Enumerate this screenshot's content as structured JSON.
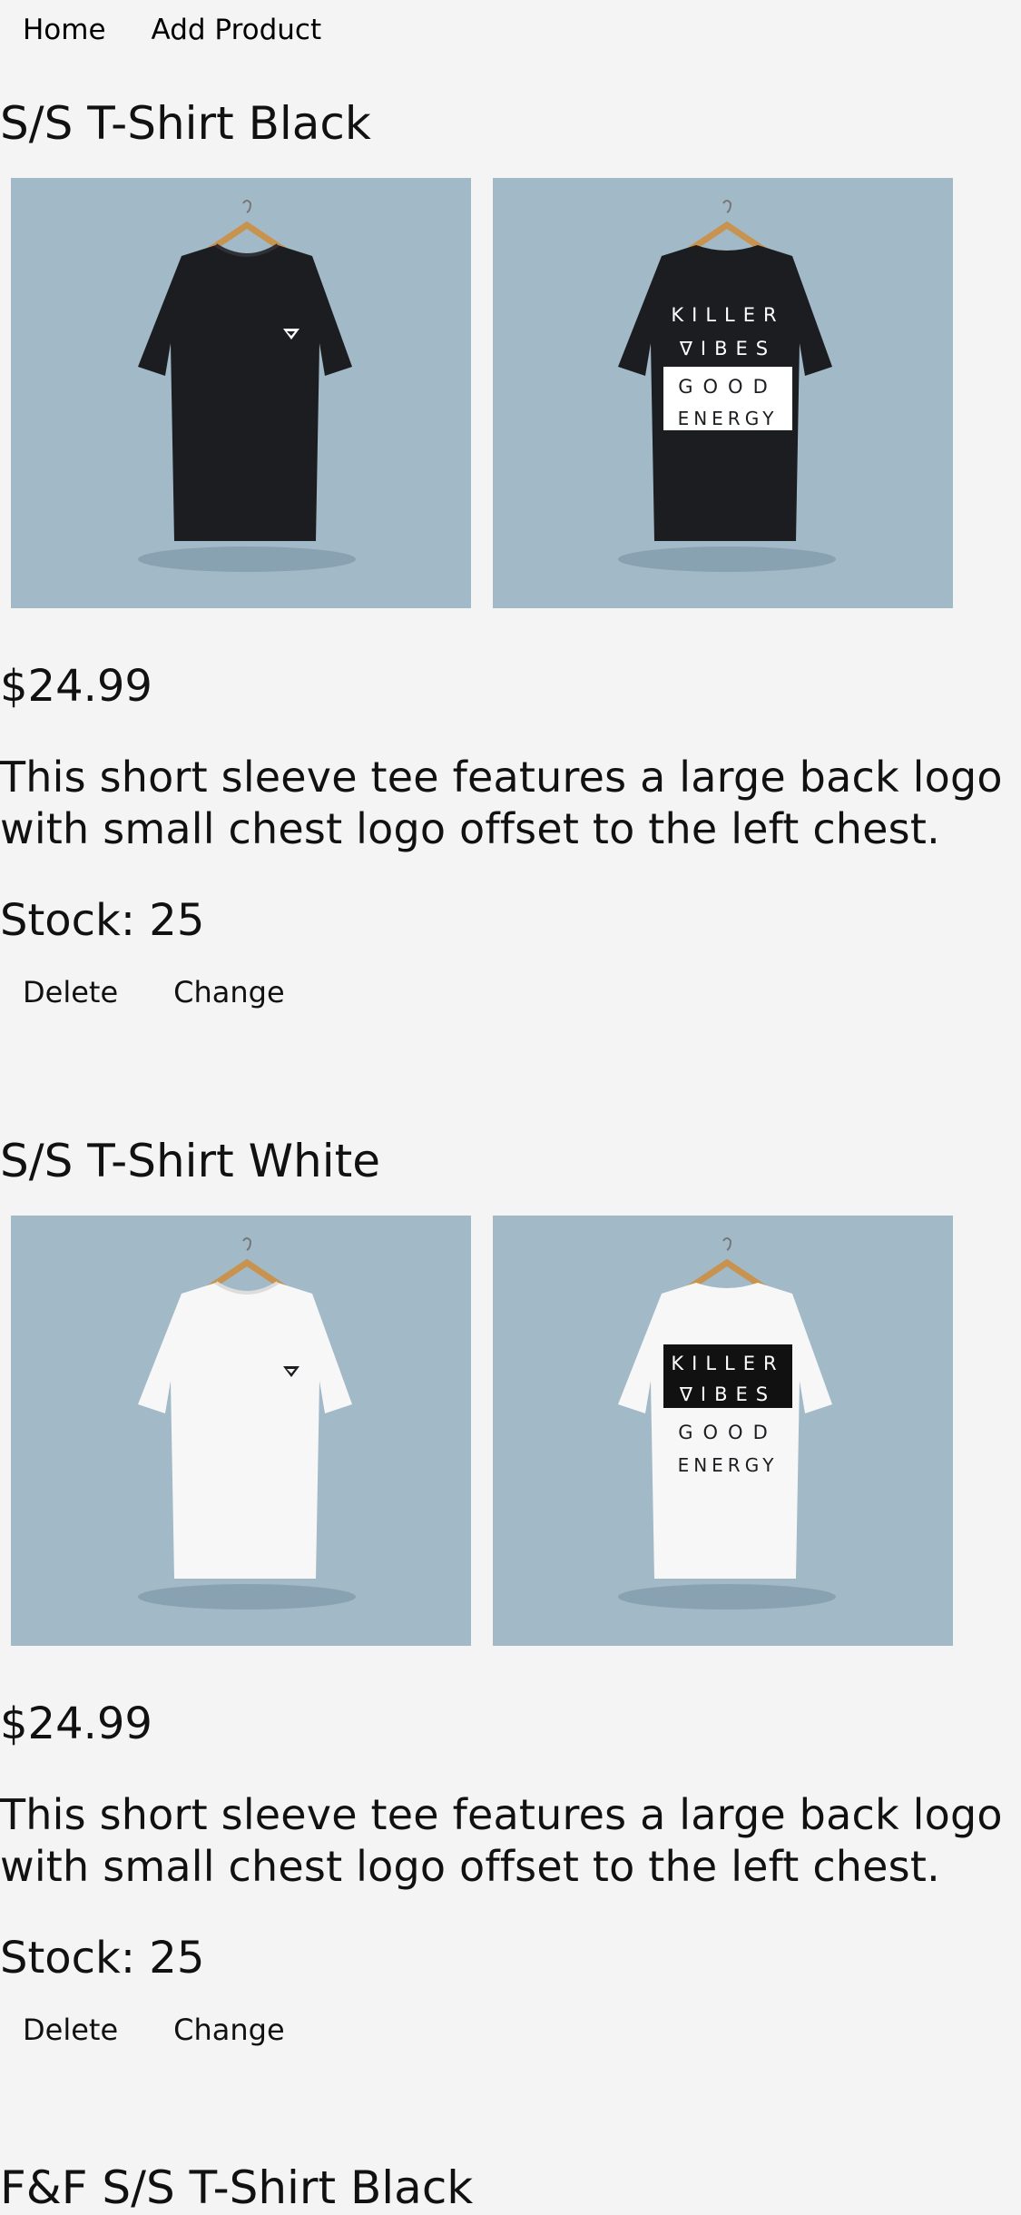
{
  "nav": {
    "home_label": "Home",
    "add_product_label": "Add Product"
  },
  "products": [
    {
      "title": "S/S T-Shirt Black",
      "price": "$24.99",
      "description": "This short sleeve tee features a large back logo with small chest logo offset to the left chest.",
      "stock": "Stock: 25",
      "delete_label": "Delete",
      "change_label": "Change",
      "shirt_color": "#1c1d21",
      "print": {
        "line1": "KILLER",
        "line2": "∇IBES",
        "line3": "GOOD",
        "line4": "ENERGY"
      }
    },
    {
      "title": "S/S T-Shirt White",
      "price": "$24.99",
      "description": "This short sleeve tee features a large back logo with small chest logo offset to the left chest.",
      "stock": "Stock: 25",
      "delete_label": "Delete",
      "change_label": "Change",
      "shirt_color": "#f7f7f7",
      "print": {
        "line1": "KILLER",
        "line2": "∇IBES",
        "line3": "GOOD",
        "line4": "ENERGY"
      }
    }
  ],
  "next_product_title": "F&F S/S T-Shirt Black",
  "colors": {
    "background": "#f4f4f4",
    "image_background": "#a2b9c8"
  }
}
